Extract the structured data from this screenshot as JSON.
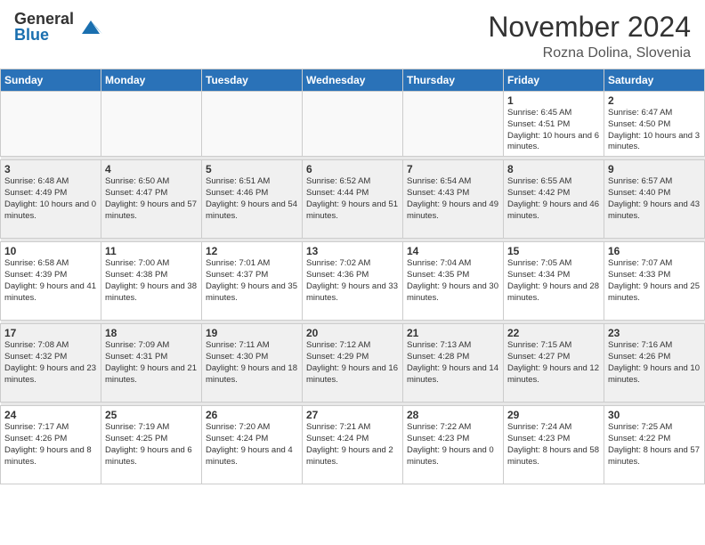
{
  "logo": {
    "general": "General",
    "blue": "Blue"
  },
  "header": {
    "month": "November 2024",
    "location": "Rozna Dolina, Slovenia"
  },
  "weekdays": [
    "Sunday",
    "Monday",
    "Tuesday",
    "Wednesday",
    "Thursday",
    "Friday",
    "Saturday"
  ],
  "weeks": [
    [
      {
        "day": "",
        "info": ""
      },
      {
        "day": "",
        "info": ""
      },
      {
        "day": "",
        "info": ""
      },
      {
        "day": "",
        "info": ""
      },
      {
        "day": "",
        "info": ""
      },
      {
        "day": "1",
        "info": "Sunrise: 6:45 AM\nSunset: 4:51 PM\nDaylight: 10 hours and 6 minutes."
      },
      {
        "day": "2",
        "info": "Sunrise: 6:47 AM\nSunset: 4:50 PM\nDaylight: 10 hours and 3 minutes."
      }
    ],
    [
      {
        "day": "3",
        "info": "Sunrise: 6:48 AM\nSunset: 4:49 PM\nDaylight: 10 hours and 0 minutes."
      },
      {
        "day": "4",
        "info": "Sunrise: 6:50 AM\nSunset: 4:47 PM\nDaylight: 9 hours and 57 minutes."
      },
      {
        "day": "5",
        "info": "Sunrise: 6:51 AM\nSunset: 4:46 PM\nDaylight: 9 hours and 54 minutes."
      },
      {
        "day": "6",
        "info": "Sunrise: 6:52 AM\nSunset: 4:44 PM\nDaylight: 9 hours and 51 minutes."
      },
      {
        "day": "7",
        "info": "Sunrise: 6:54 AM\nSunset: 4:43 PM\nDaylight: 9 hours and 49 minutes."
      },
      {
        "day": "8",
        "info": "Sunrise: 6:55 AM\nSunset: 4:42 PM\nDaylight: 9 hours and 46 minutes."
      },
      {
        "day": "9",
        "info": "Sunrise: 6:57 AM\nSunset: 4:40 PM\nDaylight: 9 hours and 43 minutes."
      }
    ],
    [
      {
        "day": "10",
        "info": "Sunrise: 6:58 AM\nSunset: 4:39 PM\nDaylight: 9 hours and 41 minutes."
      },
      {
        "day": "11",
        "info": "Sunrise: 7:00 AM\nSunset: 4:38 PM\nDaylight: 9 hours and 38 minutes."
      },
      {
        "day": "12",
        "info": "Sunrise: 7:01 AM\nSunset: 4:37 PM\nDaylight: 9 hours and 35 minutes."
      },
      {
        "day": "13",
        "info": "Sunrise: 7:02 AM\nSunset: 4:36 PM\nDaylight: 9 hours and 33 minutes."
      },
      {
        "day": "14",
        "info": "Sunrise: 7:04 AM\nSunset: 4:35 PM\nDaylight: 9 hours and 30 minutes."
      },
      {
        "day": "15",
        "info": "Sunrise: 7:05 AM\nSunset: 4:34 PM\nDaylight: 9 hours and 28 minutes."
      },
      {
        "day": "16",
        "info": "Sunrise: 7:07 AM\nSunset: 4:33 PM\nDaylight: 9 hours and 25 minutes."
      }
    ],
    [
      {
        "day": "17",
        "info": "Sunrise: 7:08 AM\nSunset: 4:32 PM\nDaylight: 9 hours and 23 minutes."
      },
      {
        "day": "18",
        "info": "Sunrise: 7:09 AM\nSunset: 4:31 PM\nDaylight: 9 hours and 21 minutes."
      },
      {
        "day": "19",
        "info": "Sunrise: 7:11 AM\nSunset: 4:30 PM\nDaylight: 9 hours and 18 minutes."
      },
      {
        "day": "20",
        "info": "Sunrise: 7:12 AM\nSunset: 4:29 PM\nDaylight: 9 hours and 16 minutes."
      },
      {
        "day": "21",
        "info": "Sunrise: 7:13 AM\nSunset: 4:28 PM\nDaylight: 9 hours and 14 minutes."
      },
      {
        "day": "22",
        "info": "Sunrise: 7:15 AM\nSunset: 4:27 PM\nDaylight: 9 hours and 12 minutes."
      },
      {
        "day": "23",
        "info": "Sunrise: 7:16 AM\nSunset: 4:26 PM\nDaylight: 9 hours and 10 minutes."
      }
    ],
    [
      {
        "day": "24",
        "info": "Sunrise: 7:17 AM\nSunset: 4:26 PM\nDaylight: 9 hours and 8 minutes."
      },
      {
        "day": "25",
        "info": "Sunrise: 7:19 AM\nSunset: 4:25 PM\nDaylight: 9 hours and 6 minutes."
      },
      {
        "day": "26",
        "info": "Sunrise: 7:20 AM\nSunset: 4:24 PM\nDaylight: 9 hours and 4 minutes."
      },
      {
        "day": "27",
        "info": "Sunrise: 7:21 AM\nSunset: 4:24 PM\nDaylight: 9 hours and 2 minutes."
      },
      {
        "day": "28",
        "info": "Sunrise: 7:22 AM\nSunset: 4:23 PM\nDaylight: 9 hours and 0 minutes."
      },
      {
        "day": "29",
        "info": "Sunrise: 7:24 AM\nSunset: 4:23 PM\nDaylight: 8 hours and 58 minutes."
      },
      {
        "day": "30",
        "info": "Sunrise: 7:25 AM\nSunset: 4:22 PM\nDaylight: 8 hours and 57 minutes."
      }
    ]
  ]
}
